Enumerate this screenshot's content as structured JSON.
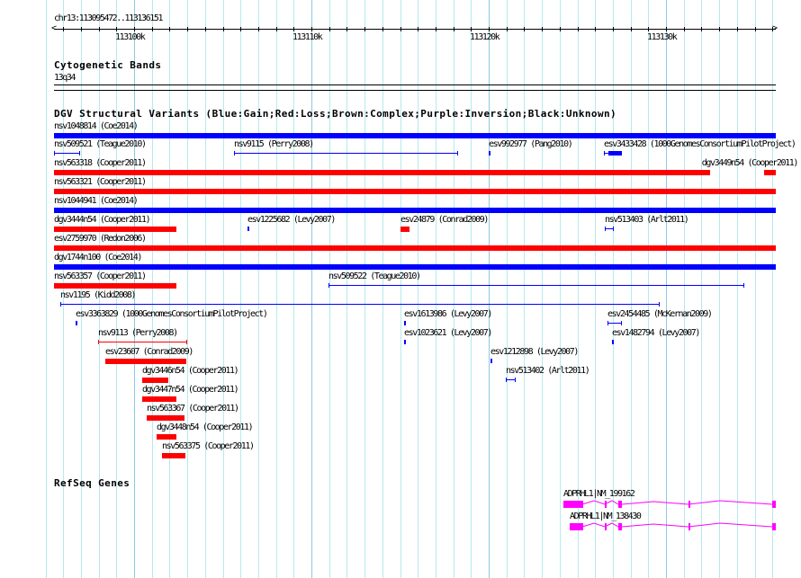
{
  "ruler": {
    "location": "chr13:113095472..113136151",
    "tick_labels": [
      "113100k",
      "113110k",
      "113120k",
      "113130k"
    ]
  },
  "cytoband": {
    "title": "Cytogenetic Bands",
    "band": "13q34"
  },
  "dgv": {
    "title": "DGV Structural Variants (Blue:Gain;Red:Loss;Brown:Complex;Purple:Inversion;Black:Unknown)",
    "colors": {
      "gain": "#0000ff",
      "loss": "#ff0000"
    },
    "features": [
      "nsv1048814 (Coe2014)",
      "nsv509521 (Teague2010)",
      "nsv9115 (Perry2008)",
      "esv992977 (Pang2010)",
      "esv3433428 (1000GenomesConsortiumPilotProject)",
      "nsv563318 (Cooper2011)",
      "dgv3449n54 (Cooper2011)",
      "nsv563321 (Cooper2011)",
      "nsv1044941 (Coe2014)",
      "dgv3444n54 (Cooper2011)",
      "esv1225682 (Levy2007)",
      "esv24879 (Conrad2009)",
      "nsv513403 (Arlt2011)",
      "esv2759970 (Redon2006)",
      "dgv1744n100 (Coe2014)",
      "nsv563357 (Cooper2011)",
      "nsv509522 (Teague2010)",
      "nsv1195 (Kidd2008)",
      "esv3363829 (1000GenomesConsortiumPilotProject)",
      "esv1613986 (Levy2007)",
      "esv2454485 (McKernan2009)",
      "nsv9113 (Perry2008)",
      "esv1023621 (Levy2007)",
      "esv1482794 (Levy2007)",
      "esv23607 (Conrad2009)",
      "esv1212898 (Levy2007)",
      "dgv3446n54 (Cooper2011)",
      "nsv513402 (Arlt2011)",
      "dgv3447n54 (Cooper2011)",
      "nsv563367 (Cooper2011)",
      "dgv3448n54 (Cooper2011)",
      "nsv563375 (Cooper2011)"
    ]
  },
  "refseq": {
    "title": "RefSeq Genes",
    "color": "#ff00ff",
    "genes": [
      "ADPRHL1|NM_199162",
      "ADPRHL1|NM_138430"
    ]
  }
}
